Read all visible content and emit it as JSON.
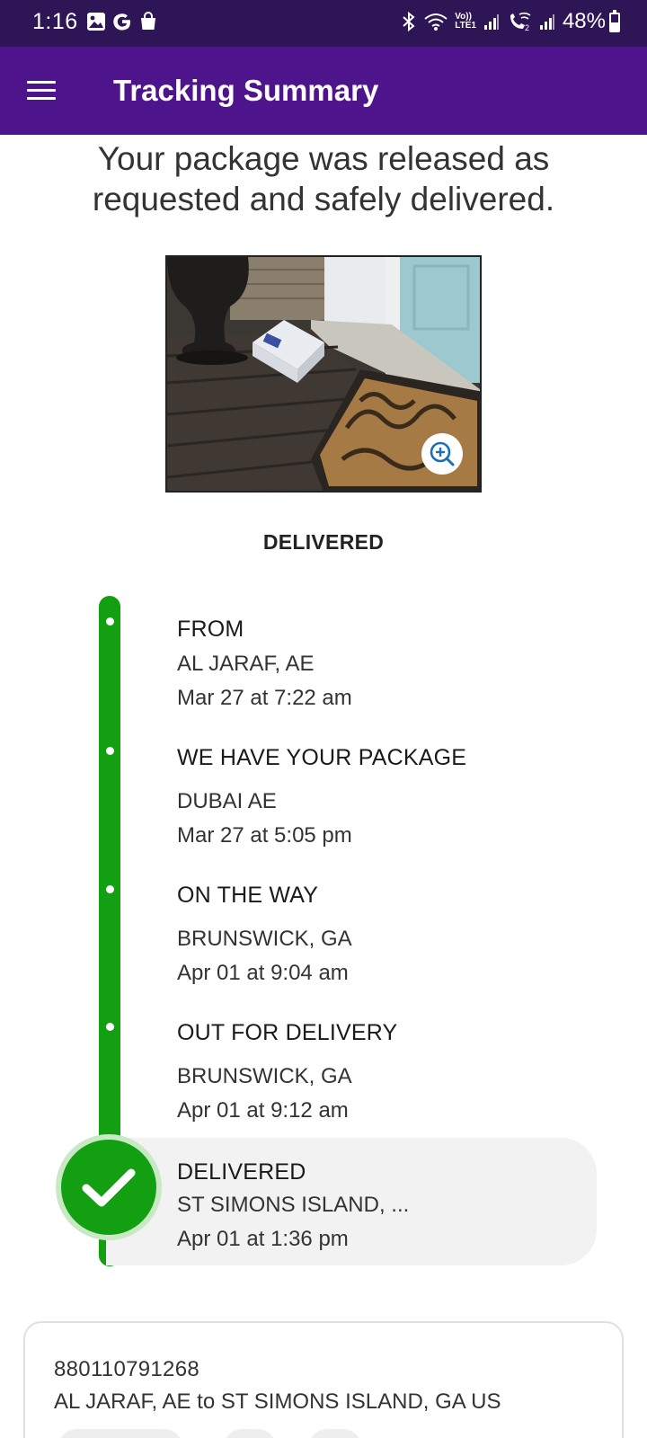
{
  "status_bar": {
    "time": "1:16",
    "battery": "48%",
    "battery_level": 0.48,
    "icons": [
      "gallery-icon",
      "google-icon",
      "shopping-bag-icon",
      "bluetooth-icon",
      "wifi-icon",
      "volte-icon",
      "signal-icon",
      "wifi-calling-icon",
      "signal-icon-2"
    ],
    "network_labels": {
      "volte": "Vo))",
      "lte": "LTE1",
      "sim": "2"
    }
  },
  "app_bar": {
    "title": "Tracking Summary",
    "menu_icon": "hamburger-menu-icon",
    "color": "#4d148c"
  },
  "message": {
    "line1": "Your package was released as",
    "line2": "requested and safely delivered."
  },
  "photo": {
    "description_icon": "delivery-photo",
    "zoom_icon": "zoom-in-icon"
  },
  "status_heading": "DELIVERED",
  "timeline": {
    "color": "#12a012",
    "steps": [
      {
        "title": "FROM",
        "location": "AL JARAF, AE",
        "time": "Mar 27 at 7:22 am"
      },
      {
        "title": "WE HAVE YOUR PACKAGE",
        "location": "DUBAI AE",
        "time": "Mar 27 at 5:05 pm"
      },
      {
        "title": "ON THE WAY",
        "location": "BRUNSWICK, GA",
        "time": "Apr 01 at 9:04 am"
      },
      {
        "title": "OUT FOR DELIVERY",
        "location": "BRUNSWICK, GA",
        "time": "Apr 01 at 9:12 am"
      },
      {
        "title": "DELIVERED",
        "location": "ST SIMONS ISLAND, ...",
        "time": "Apr 01 at 1:36 pm"
      }
    ]
  },
  "card": {
    "tracking_number": "880110791268",
    "route": "AL JARAF, AE to ST SIMONS ISLAND, GA US"
  }
}
